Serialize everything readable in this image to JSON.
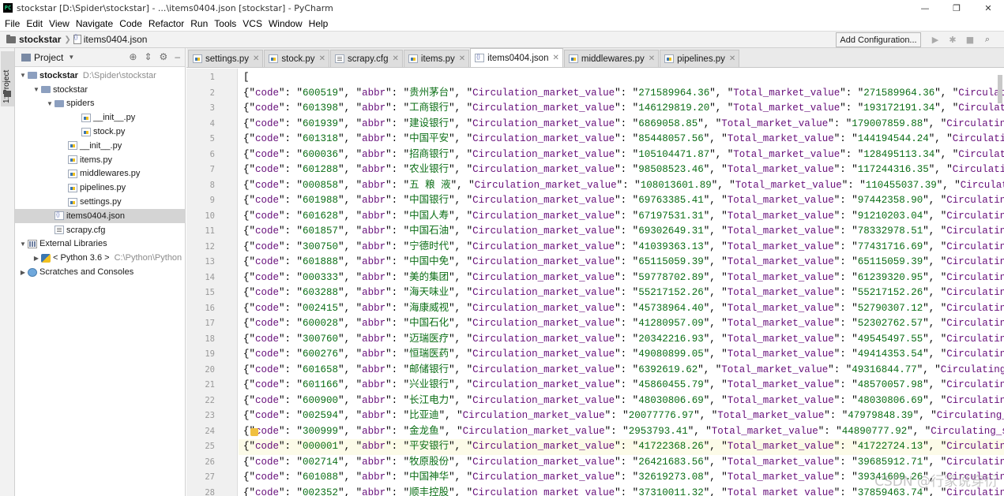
{
  "window": {
    "title": "stockstar [D:\\Spider\\stockstar] - ...\\items0404.json [stockstar] - PyCharm",
    "app_icon": "PC",
    "controls": [
      "—",
      "❐",
      "✕"
    ]
  },
  "menu": [
    "File",
    "Edit",
    "View",
    "Navigate",
    "Code",
    "Refactor",
    "Run",
    "Tools",
    "VCS",
    "Window",
    "Help"
  ],
  "navbar": {
    "project": "stockstar",
    "file": "items0404.json",
    "add_config": "Add Configuration..."
  },
  "sidebar_strip": {
    "label": "1: Project"
  },
  "project_panel": {
    "header": "Project",
    "tree": [
      {
        "label": "stockstar",
        "hint": "D:\\Spider\\stockstar",
        "icon": "folder-icon",
        "indent": 0,
        "arrow": "▼",
        "bold": true
      },
      {
        "label": "stockstar",
        "hint": "",
        "icon": "folder-icon",
        "indent": 1,
        "arrow": "▼"
      },
      {
        "label": "spiders",
        "hint": "",
        "icon": "folder-icon",
        "indent": 2,
        "arrow": "▼"
      },
      {
        "label": "__init__.py",
        "hint": "",
        "icon": "python-file-icon",
        "indent": 4,
        "arrow": ""
      },
      {
        "label": "stock.py",
        "hint": "",
        "icon": "python-file-icon",
        "indent": 4,
        "arrow": ""
      },
      {
        "label": "__init__.py",
        "hint": "",
        "icon": "python-file-icon",
        "indent": 3,
        "arrow": ""
      },
      {
        "label": "items.py",
        "hint": "",
        "icon": "python-file-icon",
        "indent": 3,
        "arrow": ""
      },
      {
        "label": "middlewares.py",
        "hint": "",
        "icon": "python-file-icon",
        "indent": 3,
        "arrow": ""
      },
      {
        "label": "pipelines.py",
        "hint": "",
        "icon": "python-file-icon",
        "indent": 3,
        "arrow": ""
      },
      {
        "label": "settings.py",
        "hint": "",
        "icon": "python-file-icon",
        "indent": 3,
        "arrow": ""
      },
      {
        "label": "items0404.json",
        "hint": "",
        "icon": "json-file-icon",
        "indent": 2,
        "arrow": "",
        "selected": true
      },
      {
        "label": "scrapy.cfg",
        "hint": "",
        "icon": "cfg-file-icon",
        "indent": 2,
        "arrow": ""
      },
      {
        "label": "External Libraries",
        "hint": "",
        "icon": "library-icon",
        "indent": 0,
        "arrow": "▼"
      },
      {
        "label": "< Python 3.6 >",
        "hint": "C:\\Python\\Python",
        "icon": "python-sdk-icon",
        "indent": 1,
        "arrow": "▶"
      },
      {
        "label": "Scratches and Consoles",
        "hint": "",
        "icon": "scratches-icon",
        "indent": 0,
        "arrow": "▶"
      }
    ]
  },
  "tabs": [
    {
      "label": "settings.py",
      "icon": "python-file-icon",
      "active": false
    },
    {
      "label": "stock.py",
      "icon": "python-file-icon",
      "active": false
    },
    {
      "label": "scrapy.cfg",
      "icon": "cfg-file-icon",
      "active": false
    },
    {
      "label": "items.py",
      "icon": "python-file-icon",
      "active": false
    },
    {
      "label": "items0404.json",
      "icon": "json-file-icon",
      "active": true
    },
    {
      "label": "middlewares.py",
      "icon": "python-file-icon",
      "active": false
    },
    {
      "label": "pipelines.py",
      "icon": "python-file-icon",
      "active": false
    }
  ],
  "editor": {
    "current_line": 25,
    "bulb_line": 24,
    "first_line": "[",
    "keys": {
      "code": "code",
      "abbr": "abbr",
      "circ": "Circulation_market_value",
      "total": "Total_market_value",
      "circ_share": "Circulating_share_capital"
    },
    "rows": [
      {
        "code": "600519",
        "abbr": "贵州茅台",
        "circ": "271589964.36",
        "total": "271589964.36"
      },
      {
        "code": "601398",
        "abbr": "工商银行",
        "circ": "146129819.20",
        "total": "193172191.34"
      },
      {
        "code": "601939",
        "abbr": "建设银行",
        "circ": "6869058.85",
        "total": "179007859.88"
      },
      {
        "code": "601318",
        "abbr": "中国平安",
        "circ": "85448057.56",
        "total": "144194544.24"
      },
      {
        "code": "600036",
        "abbr": "招商银行",
        "circ": "105104471.87",
        "total": "128495113.34"
      },
      {
        "code": "601288",
        "abbr": "农业银行",
        "circ": "98508523.46",
        "total": "117244316.35"
      },
      {
        "code": "000858",
        "abbr": "五 粮 液",
        "circ": "108013601.89",
        "total": "110455037.39"
      },
      {
        "code": "601988",
        "abbr": "中国银行",
        "circ": "69763385.41",
        "total": "97442358.90"
      },
      {
        "code": "601628",
        "abbr": "中国人寿",
        "circ": "67197531.31",
        "total": "91210203.04"
      },
      {
        "code": "601857",
        "abbr": "中国石油",
        "circ": "69302649.31",
        "total": "78332978.51"
      },
      {
        "code": "300750",
        "abbr": "宁德时代",
        "circ": "41039363.13",
        "total": "77431716.69"
      },
      {
        "code": "601888",
        "abbr": "中国中免",
        "circ": "65115059.39",
        "total": "65115059.39"
      },
      {
        "code": "000333",
        "abbr": "美的集团",
        "circ": "59778702.89",
        "total": "61239320.95"
      },
      {
        "code": "603288",
        "abbr": "海天味业",
        "circ": "55217152.26",
        "total": "55217152.26"
      },
      {
        "code": "002415",
        "abbr": "海康威视",
        "circ": "45738964.40",
        "total": "52790307.12"
      },
      {
        "code": "600028",
        "abbr": "中国石化",
        "circ": "41280957.09",
        "total": "52302762.57"
      },
      {
        "code": "300760",
        "abbr": "迈瑞医疗",
        "circ": "20342216.93",
        "total": "49545497.55"
      },
      {
        "code": "600276",
        "abbr": "恒瑞医药",
        "circ": "49080899.05",
        "total": "49414353.54"
      },
      {
        "code": "601658",
        "abbr": "邮储银行",
        "circ": "6392619.62",
        "total": "49316844.77"
      },
      {
        "code": "601166",
        "abbr": "兴业银行",
        "circ": "45860455.79",
        "total": "48570057.98"
      },
      {
        "code": "600900",
        "abbr": "长江电力",
        "circ": "48030806.69",
        "total": "48030806.69"
      },
      {
        "code": "002594",
        "abbr": "比亚迪",
        "circ": "20077776.97",
        "total": "47979848.39"
      },
      {
        "code": "300999",
        "abbr": "金龙鱼",
        "circ": "2953793.41",
        "total": "44890777.92"
      },
      {
        "code": "000001",
        "abbr": "平安银行",
        "circ": "41722368.26",
        "total": "41722724.13"
      },
      {
        "code": "002714",
        "abbr": "牧原股份",
        "circ": "26421683.56",
        "total": "39685912.71"
      },
      {
        "code": "601088",
        "abbr": "中国神华",
        "circ": "32619273.08",
        "total": "39341609.26"
      },
      {
        "code": "002352",
        "abbr": "顺丰控股",
        "circ": "37310011.32",
        "total": "37859463.74"
      }
    ]
  },
  "watermark": "CSDN @行家说穿衍",
  "colors": {
    "json_key": "#660e7a",
    "json_string": "#0b6e16",
    "current_line": "#fcfbe8",
    "selection": "#d4d4d4"
  }
}
